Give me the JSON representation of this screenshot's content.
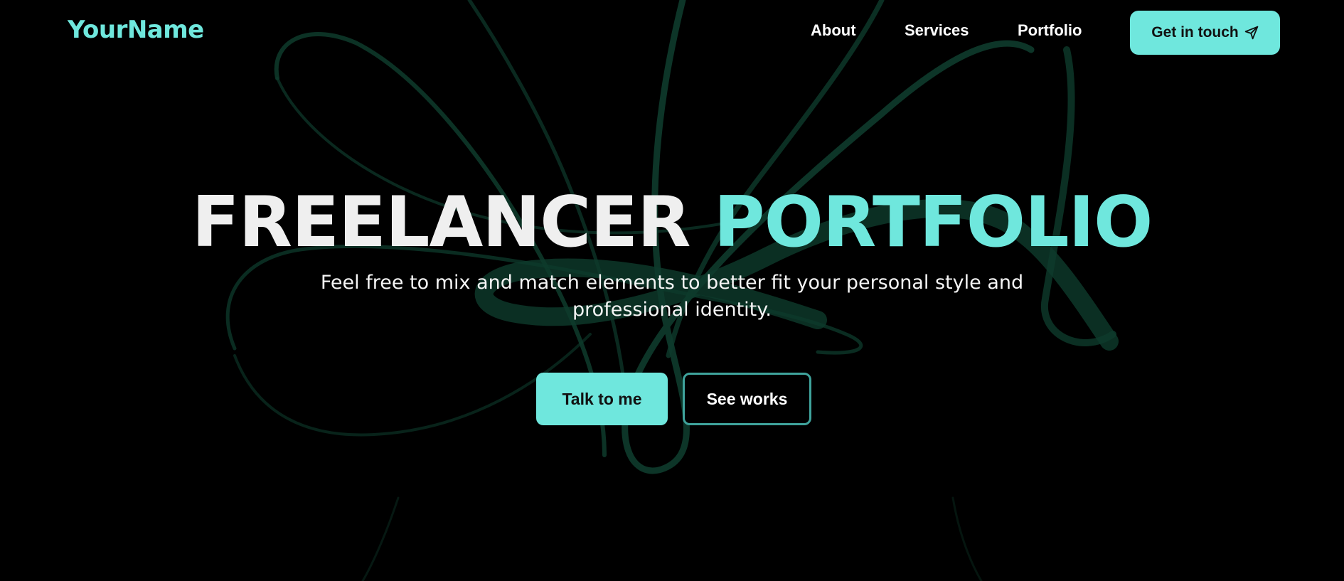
{
  "theme": {
    "background": "#000000",
    "accent": "#6fe7dd",
    "art_color": "#0d3a2a",
    "outline_border": "#3fa39c"
  },
  "header": {
    "logo": "YourName",
    "nav": {
      "about": "About",
      "services": "Services",
      "portfolio": "Portfolio"
    },
    "cta": {
      "label": "Get in touch",
      "icon": "send-icon"
    }
  },
  "hero": {
    "title_part1": "FREELANCER",
    "title_part2": "PORTFOLIO",
    "subtitle": "Feel free to mix and match elements to better fit your personal style and professional identity.",
    "buttons": {
      "primary": "Talk to me",
      "secondary": "See works"
    }
  }
}
